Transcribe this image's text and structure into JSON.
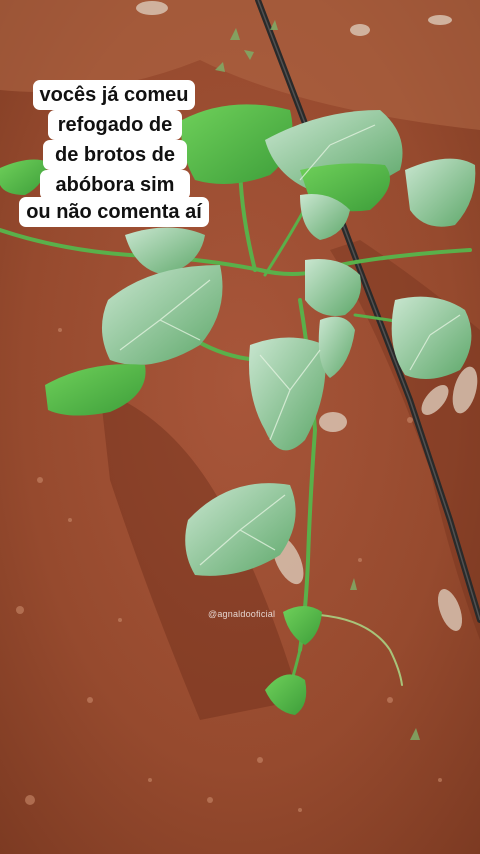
{
  "caption": {
    "lines": [
      "vocês já comeu",
      "refogado de",
      "de brotos de",
      "abóbora sim",
      "ou não comenta aí"
    ]
  },
  "watermark": "@agnaldooficial",
  "scene": {
    "subject": "pumpkin-seedling-on-soil",
    "colors": {
      "soil": "#9a4a2c",
      "soil_dark": "#6e2f1a",
      "leaf": "#5fbf4a",
      "leaf_light": "#b9dcc3",
      "hose": "#2a2a2a"
    }
  }
}
